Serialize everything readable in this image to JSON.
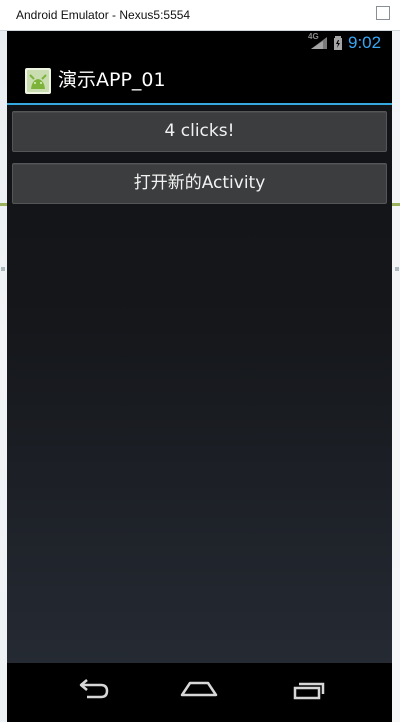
{
  "window": {
    "title": "Android Emulator - Nexus5:5554"
  },
  "statusbar": {
    "network": "4G",
    "time": "9:02",
    "time_color": "#38a7f3"
  },
  "actionbar": {
    "app_icon": "android-app-icon",
    "title": "演示APP_01",
    "divider_color": "#35a9de"
  },
  "main": {
    "buttons": [
      {
        "label": "4 clicks!"
      },
      {
        "label": "打开新的Activity"
      }
    ]
  },
  "navbar": {
    "back_icon": "back-arrow-icon",
    "home_icon": "home-icon",
    "recents_icon": "recent-apps-icon"
  }
}
